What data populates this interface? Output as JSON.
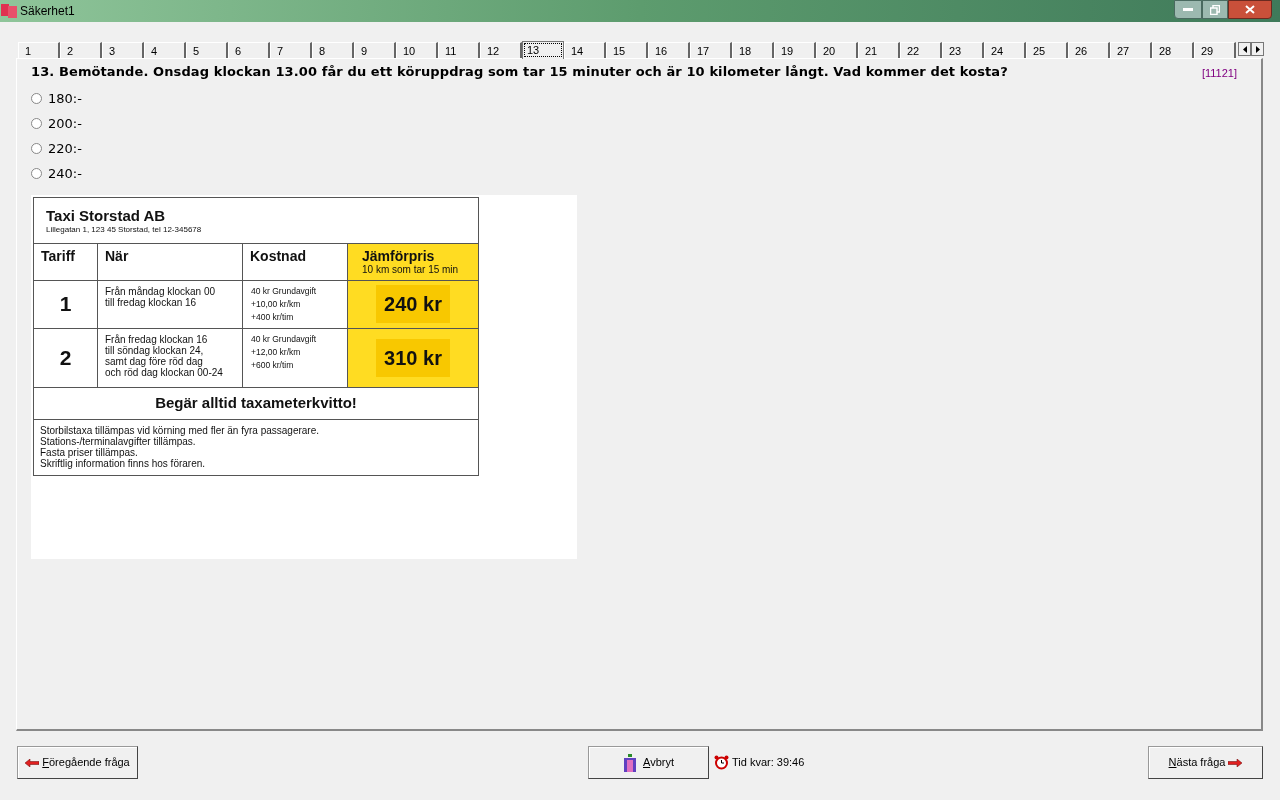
{
  "window": {
    "title": "Säkerhet1"
  },
  "tabs": [
    {
      "label": "1",
      "selected": false
    },
    {
      "label": "2",
      "selected": false
    },
    {
      "label": "3",
      "selected": false
    },
    {
      "label": "4",
      "selected": false
    },
    {
      "label": "5",
      "selected": false
    },
    {
      "label": "6",
      "selected": false
    },
    {
      "label": "7",
      "selected": false
    },
    {
      "label": "8",
      "selected": false
    },
    {
      "label": "9",
      "selected": false
    },
    {
      "label": "10",
      "selected": false
    },
    {
      "label": "11",
      "selected": false
    },
    {
      "label": "12",
      "selected": false
    },
    {
      "label": "13",
      "selected": true
    },
    {
      "label": "14",
      "selected": false
    },
    {
      "label": "15",
      "selected": false
    },
    {
      "label": "16",
      "selected": false
    },
    {
      "label": "17",
      "selected": false
    },
    {
      "label": "18",
      "selected": false
    },
    {
      "label": "19",
      "selected": false
    },
    {
      "label": "20",
      "selected": false
    },
    {
      "label": "21",
      "selected": false
    },
    {
      "label": "22",
      "selected": false
    },
    {
      "label": "23",
      "selected": false
    },
    {
      "label": "24",
      "selected": false
    },
    {
      "label": "25",
      "selected": false
    },
    {
      "label": "26",
      "selected": false
    },
    {
      "label": "27",
      "selected": false
    },
    {
      "label": "28",
      "selected": false
    },
    {
      "label": "29",
      "selected": false
    }
  ],
  "question": {
    "text": "13. Bemötande. Onsdag klockan 13.00 får du ett köruppdrag som tar 15 minuter och är 10 kilometer långt. Vad kommer det kosta?",
    "code": "[11121]"
  },
  "options": [
    {
      "label": "180:-",
      "selected": false
    },
    {
      "label": "200:-",
      "selected": false
    },
    {
      "label": "220:-",
      "selected": false
    },
    {
      "label": "240:-",
      "selected": false
    }
  ],
  "price_sign": {
    "company": "Taxi Storstad AB",
    "address": "Lillegatan 1, 123 45 Storstad, tel 12-345678",
    "columns": [
      "Tariff",
      "När",
      "Kostnad",
      "Jämförpris"
    ],
    "compare_note": "10 km som tar 15 min",
    "rows": [
      {
        "tariff": "1",
        "when": [
          "Från måndag klockan 00",
          "till fredag klockan 16"
        ],
        "cost": [
          "40 kr Grundavgift",
          "+10,00 kr/km",
          "+400 kr/tim"
        ],
        "price": "240 kr"
      },
      {
        "tariff": "2",
        "when": [
          "Från fredag klockan 16",
          "till söndag klockan 24,",
          "samt dag före röd dag",
          "och röd dag klockan 00-24"
        ],
        "cost": [
          "40 kr Grundavgift",
          "+12,00 kr/km",
          "+600 kr/tim"
        ],
        "price": "310 kr"
      }
    ],
    "notice": "Begär alltid taxameterkvitto!",
    "footnotes": [
      "Storbilstaxa tillämpas vid körning med fler än fyra passagerare.",
      "Stations-/terminalavgifter tillämpas.",
      "Fasta priser tillämpas.",
      "Skriftlig information finns hos föraren."
    ]
  },
  "footer": {
    "previous": "Föregående fråga",
    "cancel": "Avbryt",
    "time_left": "Tid kvar: 39:46",
    "next": "Nästa fråga"
  }
}
